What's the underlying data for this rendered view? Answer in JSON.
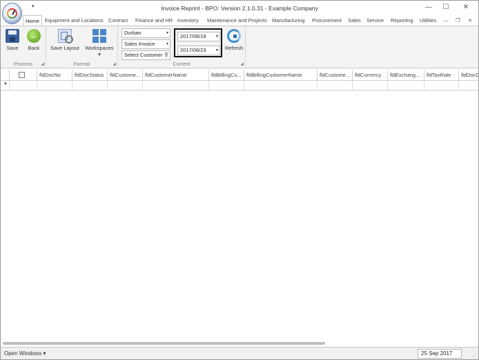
{
  "window": {
    "title": "Invoice Reprint - BPO: Version 2.1.0.31 - Example Company",
    "qat_arrow": "▾",
    "minimize": "—",
    "maximize": "☐",
    "close": "✕"
  },
  "tabs": [
    {
      "label": "Home",
      "active": true
    },
    {
      "label": "Equipment and Locations"
    },
    {
      "label": "Contract"
    },
    {
      "label": "Finance and HR"
    },
    {
      "label": "Inventory"
    },
    {
      "label": "Maintenance and Projects"
    },
    {
      "label": "Manufacturing"
    },
    {
      "label": "Procurement"
    },
    {
      "label": "Sales"
    },
    {
      "label": "Service"
    },
    {
      "label": "Reporting"
    },
    {
      "label": "Utilities"
    }
  ],
  "tab_controls": {
    "minimize": "—",
    "restore": "❐",
    "close": "✕"
  },
  "ribbon": {
    "process": {
      "label": "Process",
      "save": "Save",
      "back": "Back"
    },
    "format": {
      "label": "Format",
      "save_layout": "Save Layout",
      "workspaces": "Workspaces",
      "workspaces_arrow": "▾"
    },
    "current": {
      "label": "Current",
      "site": "Durban",
      "doc_type": "Sales Invoice",
      "customer_placeholder": "Select Customer",
      "date_from": "2017/06/19",
      "date_to": "2017/06/23",
      "refresh": "Refresh"
    }
  },
  "grid": {
    "columns": [
      "fldDocNo",
      "fldDocStatus",
      "fldCustome...",
      "fldCustomerName",
      "fldBillingCu...",
      "fldBillingCustomerName",
      "fldCustome...",
      "fldCurrency",
      "fldExchang...",
      "fldTaxRate",
      "fldDocD"
    ],
    "filter_icon": "▼"
  },
  "statusbar": {
    "open_windows": "Open Windows ▾",
    "date": "25 Sep 2017"
  }
}
